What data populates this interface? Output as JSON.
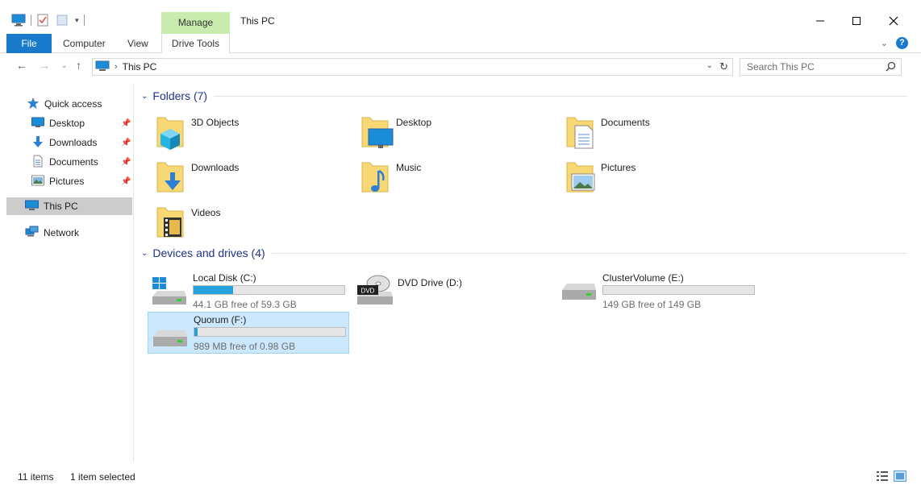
{
  "window": {
    "title": "This PC",
    "context_tab": "Manage"
  },
  "ribbon": {
    "tabs": [
      "File",
      "Computer",
      "View"
    ],
    "contextual_tab": "Drive Tools"
  },
  "address": {
    "location": "This PC",
    "search_placeholder": "Search This PC"
  },
  "sidebar": {
    "quick_access": "Quick access",
    "pinned": [
      {
        "label": "Desktop",
        "icon": "desktop-icon"
      },
      {
        "label": "Downloads",
        "icon": "downloads-icon"
      },
      {
        "label": "Documents",
        "icon": "documents-icon"
      },
      {
        "label": "Pictures",
        "icon": "pictures-icon"
      }
    ],
    "this_pc": "This PC",
    "network": "Network"
  },
  "folders": {
    "header": "Folders (7)",
    "items": [
      {
        "label": "3D Objects",
        "icon": "3d-objects-folder-icon"
      },
      {
        "label": "Desktop",
        "icon": "desktop-folder-icon"
      },
      {
        "label": "Documents",
        "icon": "documents-folder-icon"
      },
      {
        "label": "Downloads",
        "icon": "downloads-folder-icon"
      },
      {
        "label": "Music",
        "icon": "music-folder-icon"
      },
      {
        "label": "Pictures",
        "icon": "pictures-folder-icon"
      },
      {
        "label": "Videos",
        "icon": "videos-folder-icon"
      }
    ]
  },
  "drives": {
    "header": "Devices and drives (4)",
    "items": [
      {
        "label": "Local Disk (C:)",
        "free": "44.1 GB free of 59.3 GB",
        "used_fraction": 0.26,
        "selected": false
      },
      {
        "label": "DVD Drive (D:)",
        "free": "",
        "used_fraction": null,
        "selected": false
      },
      {
        "label": "ClusterVolume (E:)",
        "free": "149 GB free of 149 GB",
        "used_fraction": 0.0,
        "selected": false
      },
      {
        "label": "Quorum (F:)",
        "free": "989 MB free of 0.98 GB",
        "used_fraction": 0.02,
        "selected": true
      }
    ]
  },
  "status": {
    "items_count": "11 items",
    "selected": "1 item selected"
  },
  "colors": {
    "accent": "#1979ca",
    "manage_tab": "#c7ecae",
    "header_text": "#1e3287",
    "bar_fill": "#26a0da",
    "selection": "#cce8ff",
    "folder_yellow": "#f8d775"
  }
}
